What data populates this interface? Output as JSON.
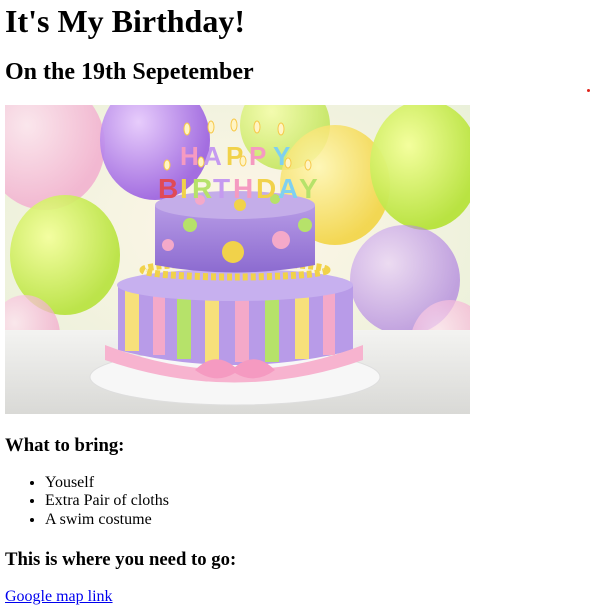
{
  "title": "It's My Birthday!",
  "subtitle": "On the 19th Sepetember",
  "image": {
    "name": "birthday-cake-image",
    "cake_text": [
      "HAPPY",
      "BIRTHDAY"
    ]
  },
  "bring": {
    "heading": "What to bring:",
    "items": [
      "Youself",
      "Extra Pair of cloths",
      "A swim costume"
    ]
  },
  "location": {
    "heading": "This is where you need to go:",
    "link_text": "Google map link"
  }
}
